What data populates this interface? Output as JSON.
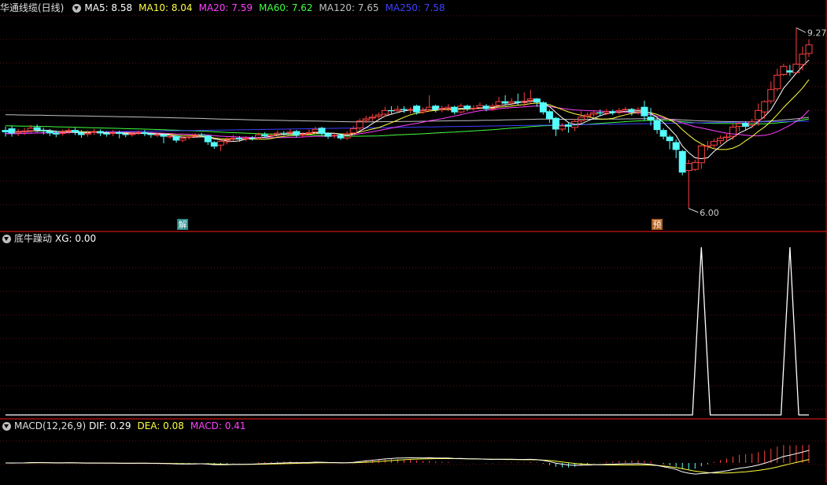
{
  "colors": {
    "background": "#000000",
    "divider": "#aa1111",
    "grid": "#661010",
    "candle_up": "#ff4040",
    "candle_down": "#54ffff",
    "ma5": "#ffffff",
    "ma10": "#ffff40",
    "ma20": "#ff40ff",
    "ma60": "#40ff40",
    "ma120": "#c0c0c0",
    "ma250": "#4040ff",
    "xg": "#ffffff",
    "dif": "#ffffff",
    "dea": "#ffff40",
    "macd_pos": "#ff4040",
    "macd_neg": "#54ffff"
  },
  "main_panel": {
    "title": "华通线缆(日线)",
    "indicators": [
      {
        "label": "MA5:",
        "value": "8.58",
        "color": "#ffffff"
      },
      {
        "label": "MA10:",
        "value": "8.04",
        "color": "#ffff40"
      },
      {
        "label": "MA20:",
        "value": "7.59",
        "color": "#ff40ff"
      },
      {
        "label": "MA60:",
        "value": "7.62",
        "color": "#40ff40"
      },
      {
        "label": "MA120:",
        "value": "7.65",
        "color": "#c0c0c0"
      },
      {
        "label": "MA250:",
        "value": "7.58",
        "color": "#4040ff"
      }
    ],
    "high_label": "9.27",
    "low_label": "6.00",
    "event_tags": [
      {
        "index": 28,
        "text": "解",
        "bg": "#2d8c8c"
      },
      {
        "index": 103,
        "text": "预",
        "bg": "#b06020"
      }
    ]
  },
  "xg_panel": {
    "title": "底牛躁动",
    "indicators": [
      {
        "label": "XG:",
        "value": "0.00",
        "color": "#ffffff"
      }
    ]
  },
  "macd_panel": {
    "title": "MACD(12,26,9)",
    "indicators": [
      {
        "label": "DIF:",
        "value": "0.29",
        "color": "#ffffff"
      },
      {
        "label": "DEA:",
        "value": "0.08",
        "color": "#ffff40"
      },
      {
        "label": "MACD:",
        "value": "0.41",
        "color": "#ff40ff"
      }
    ]
  },
  "chart_data": {
    "type": "candlestick",
    "candles": [
      [
        7.42,
        7.38,
        7.48,
        7.3
      ],
      [
        7.45,
        7.36,
        7.5,
        7.3
      ],
      [
        7.36,
        7.4,
        7.44,
        7.31
      ],
      [
        7.38,
        7.41,
        7.46,
        7.33
      ],
      [
        7.4,
        7.46,
        7.51,
        7.37
      ],
      [
        7.47,
        7.42,
        7.52,
        7.38
      ],
      [
        7.42,
        7.4,
        7.46,
        7.34
      ],
      [
        7.4,
        7.36,
        7.44,
        7.31
      ],
      [
        7.37,
        7.34,
        7.41,
        7.29
      ],
      [
        7.35,
        7.39,
        7.43,
        7.32
      ],
      [
        7.39,
        7.42,
        7.45,
        7.35
      ],
      [
        7.42,
        7.38,
        7.46,
        7.33
      ],
      [
        7.38,
        7.33,
        7.42,
        7.28
      ],
      [
        7.34,
        7.37,
        7.41,
        7.3
      ],
      [
        7.37,
        7.4,
        7.44,
        7.33
      ],
      [
        7.4,
        7.36,
        7.43,
        7.31
      ],
      [
        7.36,
        7.34,
        7.4,
        7.3
      ],
      [
        7.35,
        7.38,
        7.42,
        7.31
      ],
      [
        7.38,
        7.35,
        7.41,
        7.27
      ],
      [
        7.35,
        7.33,
        7.38,
        7.29
      ],
      [
        7.33,
        7.36,
        7.39,
        7.3
      ],
      [
        7.36,
        7.38,
        7.41,
        7.33
      ],
      [
        7.38,
        7.35,
        7.42,
        7.31
      ],
      [
        7.35,
        7.33,
        7.38,
        7.28
      ],
      [
        7.33,
        7.34,
        7.37,
        7.29
      ],
      [
        7.34,
        7.3,
        7.36,
        7.18
      ],
      [
        7.3,
        7.31,
        7.34,
        7.26
      ],
      [
        7.31,
        7.23,
        7.33,
        7.19
      ],
      [
        7.23,
        7.28,
        7.3,
        7.2
      ],
      [
        7.28,
        7.3,
        7.33,
        7.25
      ],
      [
        7.3,
        7.34,
        7.36,
        7.28
      ],
      [
        7.34,
        7.33,
        7.37,
        7.29
      ],
      [
        7.32,
        7.2,
        7.33,
        7.15
      ],
      [
        7.2,
        7.12,
        7.22,
        7.08
      ],
      [
        7.14,
        7.22,
        7.25,
        7.04
      ],
      [
        7.2,
        7.25,
        7.29,
        7.16
      ],
      [
        7.25,
        7.28,
        7.33,
        7.22
      ],
      [
        7.28,
        7.25,
        7.31,
        7.21
      ],
      [
        7.25,
        7.28,
        7.31,
        7.22
      ],
      [
        7.28,
        7.27,
        7.31,
        7.23
      ],
      [
        7.27,
        7.34,
        7.37,
        7.25
      ],
      [
        7.34,
        7.31,
        7.38,
        7.28
      ],
      [
        7.31,
        7.33,
        7.36,
        7.28
      ],
      [
        7.33,
        7.37,
        7.41,
        7.3
      ],
      [
        7.37,
        7.36,
        7.4,
        7.32
      ],
      [
        7.36,
        7.39,
        7.43,
        7.33
      ],
      [
        7.4,
        7.32,
        7.42,
        7.29
      ],
      [
        7.32,
        7.35,
        7.38,
        7.29
      ],
      [
        7.35,
        7.38,
        7.43,
        7.32
      ],
      [
        7.38,
        7.44,
        7.48,
        7.35
      ],
      [
        7.46,
        7.35,
        7.48,
        7.32
      ],
      [
        7.36,
        7.3,
        7.38,
        7.26
      ],
      [
        7.31,
        7.33,
        7.36,
        7.27
      ],
      [
        7.33,
        7.27,
        7.35,
        7.24
      ],
      [
        7.27,
        7.36,
        7.4,
        7.24
      ],
      [
        7.36,
        7.45,
        7.49,
        7.33
      ],
      [
        7.45,
        7.59,
        7.63,
        7.42
      ],
      [
        7.59,
        7.63,
        7.68,
        7.55
      ],
      [
        7.63,
        7.66,
        7.71,
        7.58
      ],
      [
        7.66,
        7.7,
        7.74,
        7.62
      ],
      [
        7.7,
        7.78,
        7.84,
        7.66
      ],
      [
        7.78,
        7.76,
        7.85,
        7.7
      ],
      [
        7.76,
        7.8,
        7.86,
        7.72
      ],
      [
        7.8,
        7.78,
        7.85,
        7.73
      ],
      [
        7.78,
        7.8,
        7.83,
        7.72
      ],
      [
        7.86,
        7.74,
        7.88,
        7.7
      ],
      [
        7.74,
        7.78,
        7.83,
        7.71
      ],
      [
        7.78,
        7.84,
        8.05,
        7.75
      ],
      [
        7.86,
        7.78,
        7.88,
        7.74
      ],
      [
        7.78,
        7.82,
        7.86,
        7.74
      ],
      [
        7.8,
        7.84,
        7.89,
        7.76
      ],
      [
        7.84,
        7.74,
        7.86,
        7.7
      ],
      [
        7.74,
        7.86,
        7.9,
        7.72
      ],
      [
        7.86,
        7.8,
        7.88,
        7.76
      ],
      [
        7.8,
        7.82,
        7.87,
        7.77
      ],
      [
        7.82,
        7.87,
        7.92,
        7.79
      ],
      [
        7.86,
        7.8,
        7.89,
        7.76
      ],
      [
        7.8,
        7.86,
        7.9,
        7.77
      ],
      [
        7.86,
        7.94,
        8.02,
        7.82
      ],
      [
        7.94,
        7.9,
        8.05,
        7.86
      ],
      [
        7.9,
        7.94,
        8.0,
        7.86
      ],
      [
        7.94,
        7.91,
        8.08,
        7.88
      ],
      [
        7.91,
        7.95,
        8.1,
        7.85
      ],
      [
        7.95,
        7.99,
        8.15,
        7.9
      ],
      [
        7.99,
        7.92,
        8.0,
        7.84
      ],
      [
        7.92,
        7.74,
        7.94,
        7.7
      ],
      [
        7.76,
        7.62,
        7.79,
        7.55
      ],
      [
        7.64,
        7.43,
        7.66,
        7.31
      ],
      [
        7.43,
        7.5,
        7.54,
        7.4
      ],
      [
        7.52,
        7.48,
        7.55,
        7.37
      ],
      [
        7.46,
        7.58,
        7.62,
        7.4
      ],
      [
        7.58,
        7.66,
        7.76,
        7.54
      ],
      [
        7.66,
        7.7,
        7.74,
        7.63
      ],
      [
        7.7,
        7.74,
        7.78,
        7.66
      ],
      [
        7.74,
        7.72,
        7.79,
        7.68
      ],
      [
        7.72,
        7.76,
        7.8,
        7.69
      ],
      [
        7.76,
        7.73,
        7.79,
        7.69
      ],
      [
        7.73,
        7.78,
        7.82,
        7.7
      ],
      [
        7.78,
        7.8,
        7.84,
        7.74
      ],
      [
        7.8,
        7.74,
        7.82,
        7.68
      ],
      [
        7.74,
        7.8,
        7.83,
        7.7
      ],
      [
        7.84,
        7.67,
        7.95,
        7.59
      ],
      [
        7.66,
        7.6,
        7.82,
        7.5
      ],
      [
        7.6,
        7.42,
        7.62,
        7.35
      ],
      [
        7.42,
        7.3,
        7.45,
        7.25
      ],
      [
        7.3,
        7.22,
        7.33,
        7.07
      ],
      [
        7.2,
        7.06,
        7.25,
        6.91
      ],
      [
        7.04,
        6.65,
        7.06,
        6.6
      ],
      [
        6.68,
        6.82,
        6.88,
        6.0
      ],
      [
        6.7,
        6.84,
        6.88,
        6.68
      ],
      [
        6.82,
        7.14,
        7.18,
        6.72
      ],
      [
        7.14,
        7.14,
        7.22,
        7.05
      ],
      [
        7.14,
        7.22,
        7.26,
        7.08
      ],
      [
        7.22,
        7.28,
        7.32,
        7.16
      ],
      [
        7.28,
        7.3,
        7.35,
        7.22
      ],
      [
        7.3,
        7.48,
        7.53,
        7.24
      ],
      [
        7.48,
        7.55,
        7.58,
        7.4
      ],
      [
        7.55,
        7.48,
        7.58,
        7.42
      ],
      [
        7.5,
        7.58,
        7.62,
        7.45
      ],
      [
        7.6,
        7.78,
        7.9,
        7.5
      ],
      [
        7.74,
        7.94,
        7.96,
        7.62
      ],
      [
        7.94,
        8.16,
        8.3,
        7.9
      ],
      [
        8.16,
        8.42,
        8.53,
        8.12
      ],
      [
        8.42,
        8.58,
        8.62,
        8.4
      ],
      [
        8.5,
        8.46,
        8.6,
        8.4
      ],
      [
        8.45,
        8.62,
        9.27,
        8.45
      ],
      [
        8.6,
        8.8,
        8.93,
        8.5
      ],
      [
        8.8,
        8.97,
        9.06,
        8.74
      ]
    ],
    "ylim": [
      5.84,
      9.46
    ],
    "ma5_end": 8.58,
    "ma10_end": 8.04,
    "ma20_end": 7.59,
    "ma60_end": 7.62,
    "ma120_end": 7.65,
    "ma250_end": 7.58,
    "xg": {
      "type": "line",
      "peaks": [
        {
          "index": 110,
          "value": 1
        },
        {
          "index": 124,
          "value": 1
        }
      ],
      "ylim": [
        0,
        1
      ]
    },
    "macd": {
      "type": "bar+line",
      "dif_end": 0.29,
      "dea_end": 0.08,
      "macd_end": 0.41
    }
  }
}
